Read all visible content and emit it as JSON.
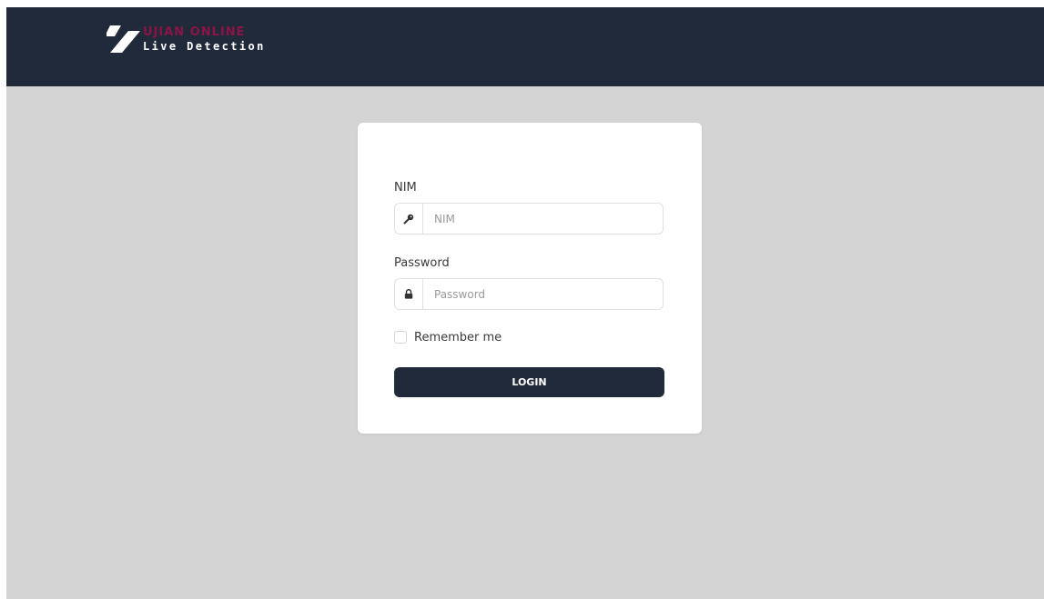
{
  "header": {
    "brand_title": "UJIAN ONLINE",
    "brand_subtitle": "Live Detection",
    "logo_icon": "slash-logo-icon"
  },
  "colors": {
    "header_bg": "#212a3b",
    "page_bg": "#d4d4d4",
    "brand_accent": "#8a1445",
    "button_bg": "#212a3b"
  },
  "login_form": {
    "nim": {
      "label": "NIM",
      "placeholder": "NIM",
      "value": "",
      "icon": "key-icon"
    },
    "password": {
      "label": "Password",
      "placeholder": "Password",
      "value": "",
      "icon": "lock-icon"
    },
    "remember_me": {
      "label": "Remember me",
      "checked": false
    },
    "submit_label": "LOGIN"
  }
}
